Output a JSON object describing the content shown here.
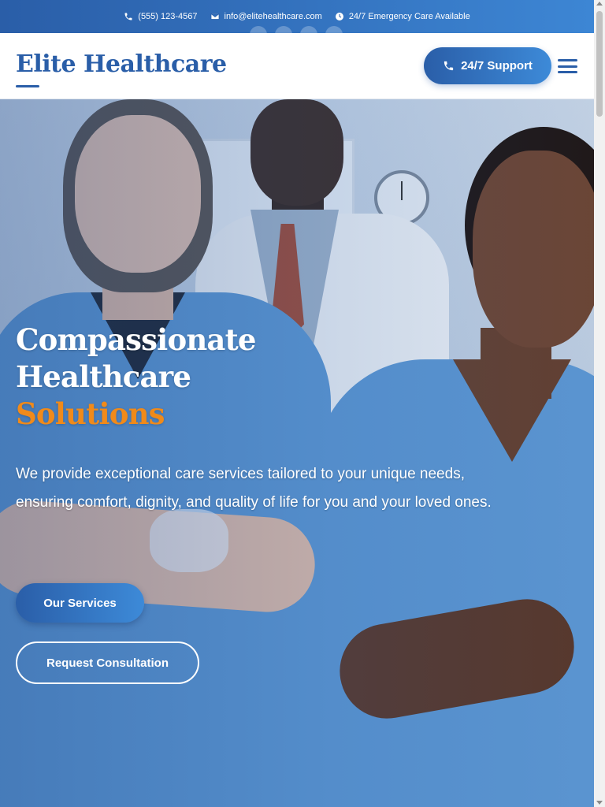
{
  "topbar": {
    "phone": "(555) 123-4567",
    "phone_icon": "phone-icon",
    "email": "info@elitehealthcare.com",
    "email_icon": "envelope-icon",
    "emergency": "24/7 Emergency Care Available",
    "emergency_icon": "clock-icon",
    "social_icons": [
      "facebook-icon",
      "twitter-icon",
      "linkedin-icon",
      "instagram-icon"
    ]
  },
  "header": {
    "logo": "Elite Healthcare",
    "support_label": "24/7 Support",
    "support_icon": "phone-icon",
    "menu_icon": "hamburger-menu-icon"
  },
  "hero": {
    "title_line1": "Compassionate",
    "title_line2": "Healthcare",
    "title_accent": "Solutions",
    "description": "We provide exceptional care services tailored to your unique needs, ensuring comfort, dignity, and quality of life for you and your loved ones.",
    "primary_cta": "Our Services",
    "secondary_cta": "Request Consultation"
  },
  "colors": {
    "brand_blue": "#2a5ea8",
    "accent_orange": "#f08a1a",
    "white": "#ffffff"
  }
}
